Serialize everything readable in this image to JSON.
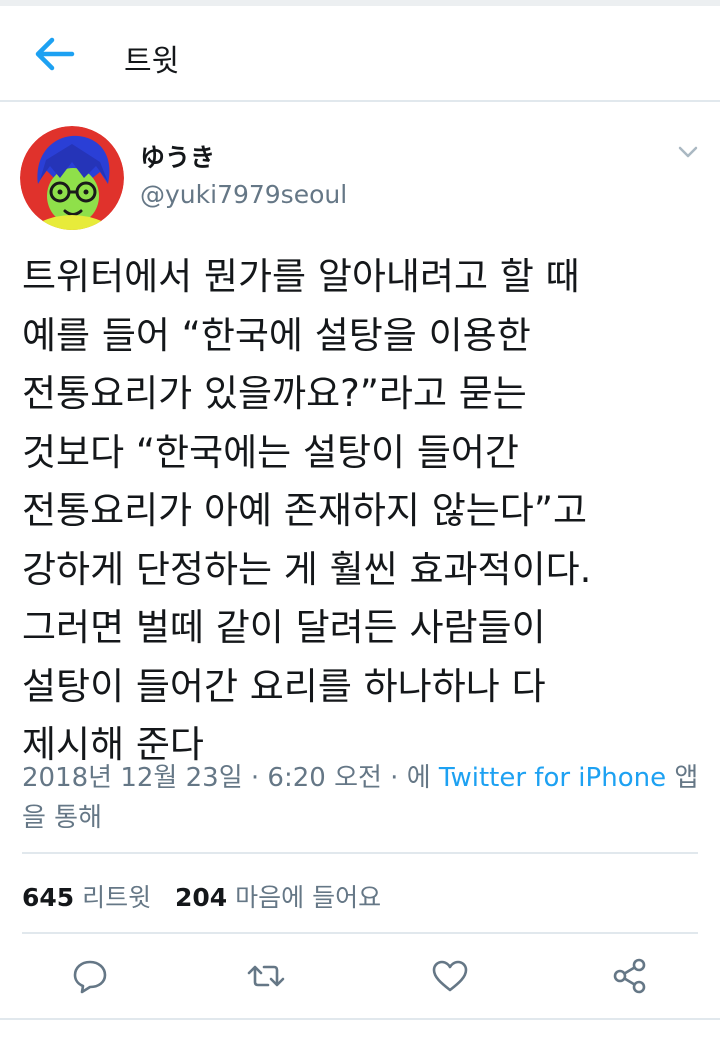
{
  "header": {
    "title": "트윗",
    "back_icon": "arrow-left-icon"
  },
  "colors": {
    "accent": "#1da1f2",
    "text_primary": "#14171a",
    "text_secondary": "#657786",
    "divider": "#e1e8ed"
  },
  "tweet": {
    "display_name": "ゆうき",
    "handle": "@yuki7979seoul",
    "text_lines": [
      "트위터에서 뭔가를 알아내려고 할 때",
      "예를 들어 “한국에 설탕을 이용한",
      "전통요리가 있을까요?”라고 묻는",
      "것보다  “한국에는 설탕이 들어간",
      "전통요리가 아예 존재하지 않는다”고",
      "강하게 단정하는 게 훨씬 효과적이다.",
      "그러면 벌떼 같이 달려든 사람들이",
      "설탕이 들어간 요리를 하나하나 다",
      "제시해 준다"
    ],
    "meta_prefix": "2018년 12월 23일 · 6:20 오전 · 에 ",
    "meta_source": "Twitter for iPhone",
    "meta_suffix": " 앱을 통해"
  },
  "stats": {
    "retweets_count": "645",
    "retweets_label": "리트윗",
    "likes_count": "204",
    "likes_label": "마음에 들어요"
  },
  "actions": [
    {
      "name": "reply",
      "icon": "reply-icon"
    },
    {
      "name": "retweet",
      "icon": "retweet-icon"
    },
    {
      "name": "like",
      "icon": "heart-icon"
    },
    {
      "name": "share",
      "icon": "share-icon"
    }
  ]
}
